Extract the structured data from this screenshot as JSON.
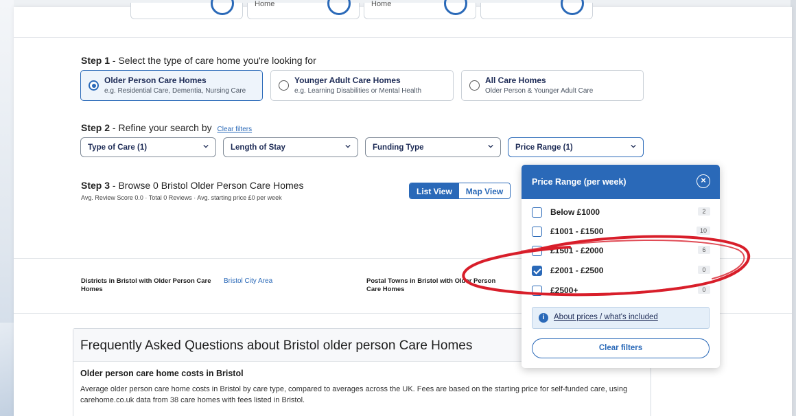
{
  "top_cards": [
    {
      "text": ""
    },
    {
      "text": "Home"
    },
    {
      "text": "Home"
    },
    {
      "text": ""
    }
  ],
  "step1": {
    "label": "Step 1",
    "text": " - Select the type of care home you're looking for",
    "options": [
      {
        "title": "Older Person Care Homes",
        "subtitle": "e.g. Residential Care, Dementia, Nursing Care",
        "selected": true
      },
      {
        "title": "Younger Adult Care Homes",
        "subtitle": "e.g. Learning Disabilities or Mental Health",
        "selected": false
      },
      {
        "title": "All Care Homes",
        "subtitle": "Older Person & Younger Adult Care",
        "selected": false
      }
    ]
  },
  "step2": {
    "label": "Step 2",
    "text": " -  Refine your search by",
    "clear_link": "Clear filters",
    "filters": [
      {
        "label": "Type of Care (1)"
      },
      {
        "label": "Length of Stay"
      },
      {
        "label": "Funding Type"
      },
      {
        "label": "Price Range (1)"
      }
    ]
  },
  "step3": {
    "label": "Step 3",
    "text": " - Browse 0 Bristol Older Person Care Homes",
    "stats": "Avg. Review Score 0.0  · Total 0 Reviews  · Avg. starting price £0 per week",
    "list_view": "List View",
    "map_view": "Map View"
  },
  "districts": {
    "label": "Districts in Bristol with Older Person Care Homes",
    "link": "Bristol City Area",
    "postal_label": "Postal Towns in Bristol with Older Person Care Homes"
  },
  "faq": {
    "title": "Frequently Asked Questions about Bristol older person Care Homes",
    "question": "Older person care home costs in Bristol",
    "answer": "Average older person care home costs in Bristol by care type, compared to averages across the UK. Fees are based on the starting price for self-funded care, using carehome.co.uk data from 38 care homes with fees listed in Bristol."
  },
  "price_popover": {
    "title": "Price Range (per week)",
    "close_icon": "×",
    "options": [
      {
        "label": "Below £1000",
        "count": "2",
        "checked": false
      },
      {
        "label": "£1001 - £1500",
        "count": "10",
        "checked": false
      },
      {
        "label": "£1501 - £2000",
        "count": "6",
        "checked": false
      },
      {
        "label": "£2001 - £2500",
        "count": "0",
        "checked": true
      },
      {
        "label": "£2500+",
        "count": "0",
        "checked": false
      }
    ],
    "info_icon": "i",
    "info_link": "About prices / what's included",
    "clear_button": "Clear filters"
  },
  "colors": {
    "primary": "#2a69b8",
    "annotation_red": "#d81e2a"
  }
}
